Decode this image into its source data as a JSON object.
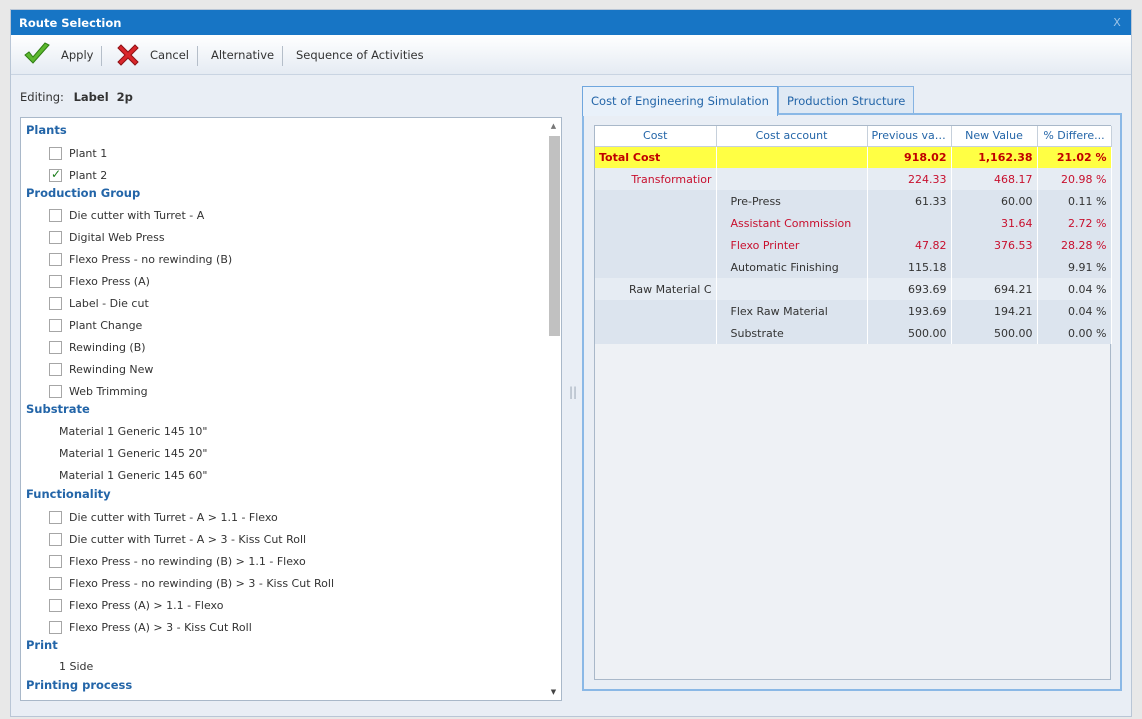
{
  "window": {
    "title": "Route Selection",
    "close_label": "X"
  },
  "toolbar": {
    "apply_label": "Apply",
    "cancel_label": "Cancel",
    "alternative_label": "Alternative",
    "sequence_label": "Sequence of Activities"
  },
  "editing": {
    "label": "Editing:",
    "value": "Label  2p"
  },
  "groups": {
    "plants": {
      "title": "Plants",
      "items": [
        {
          "label": "Plant 1",
          "checked": false
        },
        {
          "label": "Plant 2",
          "checked": true
        }
      ]
    },
    "production_group": {
      "title": "Production Group",
      "items": [
        {
          "label": "Die cutter with Turret - A",
          "checked": false
        },
        {
          "label": "Digital Web Press",
          "checked": false
        },
        {
          "label": "Flexo Press - no rewinding (B)",
          "checked": false
        },
        {
          "label": "Flexo Press (A)",
          "checked": false
        },
        {
          "label": "Label - Die cut",
          "checked": false
        },
        {
          "label": "Plant Change",
          "checked": false
        },
        {
          "label": "Rewinding (B)",
          "checked": false
        },
        {
          "label": "Rewinding New",
          "checked": false
        },
        {
          "label": "Web Trimming",
          "checked": false
        }
      ]
    },
    "substrate": {
      "title": "Substrate",
      "items": [
        "Material 1 Generic 145 10\"",
        "Material 1 Generic 145 20\"",
        "Material 1 Generic 145 60\""
      ]
    },
    "functionality": {
      "title": "Functionality",
      "items": [
        {
          "label": "Die cutter with Turret - A > 1.1 - Flexo",
          "checked": false
        },
        {
          "label": "Die cutter with Turret - A > 3 - Kiss Cut Roll",
          "checked": false
        },
        {
          "label": "Flexo Press - no rewinding (B) > 1.1 - Flexo",
          "checked": false
        },
        {
          "label": "Flexo Press - no rewinding (B) > 3 - Kiss Cut Roll",
          "checked": false
        },
        {
          "label": "Flexo Press (A) > 1.1 - Flexo",
          "checked": false
        },
        {
          "label": "Flexo Press (A) > 3 - Kiss Cut Roll",
          "checked": false
        }
      ]
    },
    "print": {
      "title": "Print",
      "items": [
        "1 Side"
      ]
    },
    "printing_process": {
      "title": "Printing process"
    }
  },
  "tabs": [
    {
      "label": "Cost of Engineering Simulation",
      "active": true
    },
    {
      "label": "Production Structure",
      "active": false
    }
  ],
  "grid": {
    "headers": [
      "Cost",
      "Cost account",
      "Previous val...",
      "New Value",
      "% Differe..."
    ],
    "rows": [
      {
        "cost": "Total Cost",
        "account": "",
        "prev": "918.02",
        "new": "1,162.38",
        "diff": "21.02 %"
      },
      {
        "cost": "Transformatior",
        "account": "",
        "prev": "224.33",
        "new": "468.17",
        "diff": "20.98 %"
      },
      {
        "cost": "",
        "account": "Pre-Press",
        "prev": "61.33",
        "new": "60.00",
        "diff": "0.11 %"
      },
      {
        "cost": "",
        "account": "Assistant Commission",
        "prev": "",
        "new": "31.64",
        "diff": "2.72 %"
      },
      {
        "cost": "",
        "account": "Flexo Printer",
        "prev": "47.82",
        "new": "376.53",
        "diff": "28.28 %"
      },
      {
        "cost": "",
        "account": "Automatic Finishing",
        "prev": "115.18",
        "new": "",
        "diff": "9.91 %"
      },
      {
        "cost": "Raw Material C",
        "account": "",
        "prev": "693.69",
        "new": "694.21",
        "diff": "0.04 %"
      },
      {
        "cost": "",
        "account": "Flex Raw Material",
        "prev": "193.69",
        "new": "194.21",
        "diff": "0.04 %"
      },
      {
        "cost": "",
        "account": "Substrate",
        "prev": "500.00",
        "new": "500.00",
        "diff": "0.00 %"
      }
    ]
  }
}
